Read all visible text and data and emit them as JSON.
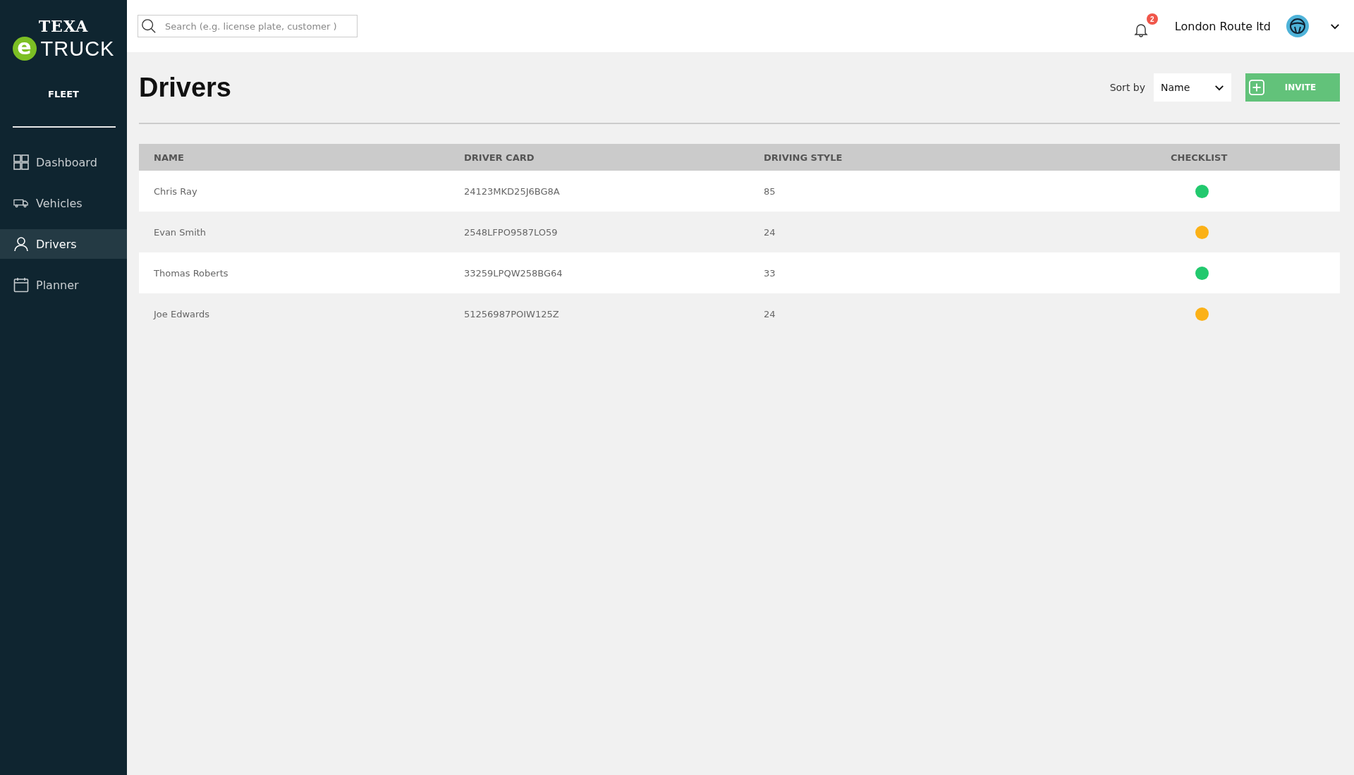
{
  "brand": {
    "top": "TEXA",
    "letter": "e",
    "name": "TRUCK",
    "section": "FLEET"
  },
  "sidebar": {
    "items": [
      {
        "label": "Dashboard",
        "selected": false
      },
      {
        "label": "Vehicles",
        "selected": false
      },
      {
        "label": "Drivers",
        "selected": true
      },
      {
        "label": "Planner",
        "selected": false
      }
    ]
  },
  "search": {
    "placeholder": "Search (e.g. license plate, customer )"
  },
  "account": {
    "notifications": "2",
    "company": "London Route ltd"
  },
  "page": {
    "title": "Drivers",
    "sort_label": "Sort by",
    "sort_value": "Name",
    "invite": "INVITE"
  },
  "table": {
    "columns": [
      "NAME",
      "DRIVER CARD",
      "DRIVING STYLE",
      "CHECKLIST"
    ],
    "rows": [
      {
        "name": "Chris Ray",
        "card": "24123MKD25J6BG8A",
        "style": "85",
        "color": "#22c96e"
      },
      {
        "name": "Evan Smith",
        "card": "2548LFPO9587LO59",
        "style": "24",
        "color": "#fbb117"
      },
      {
        "name": "Thomas Roberts",
        "card": "33259LPQW258BG64",
        "style": "33",
        "color": "#22c96e"
      },
      {
        "name": "Joe Edwards",
        "card": "51256987POIW125Z",
        "style": "24",
        "color": "#fbb117"
      }
    ]
  }
}
